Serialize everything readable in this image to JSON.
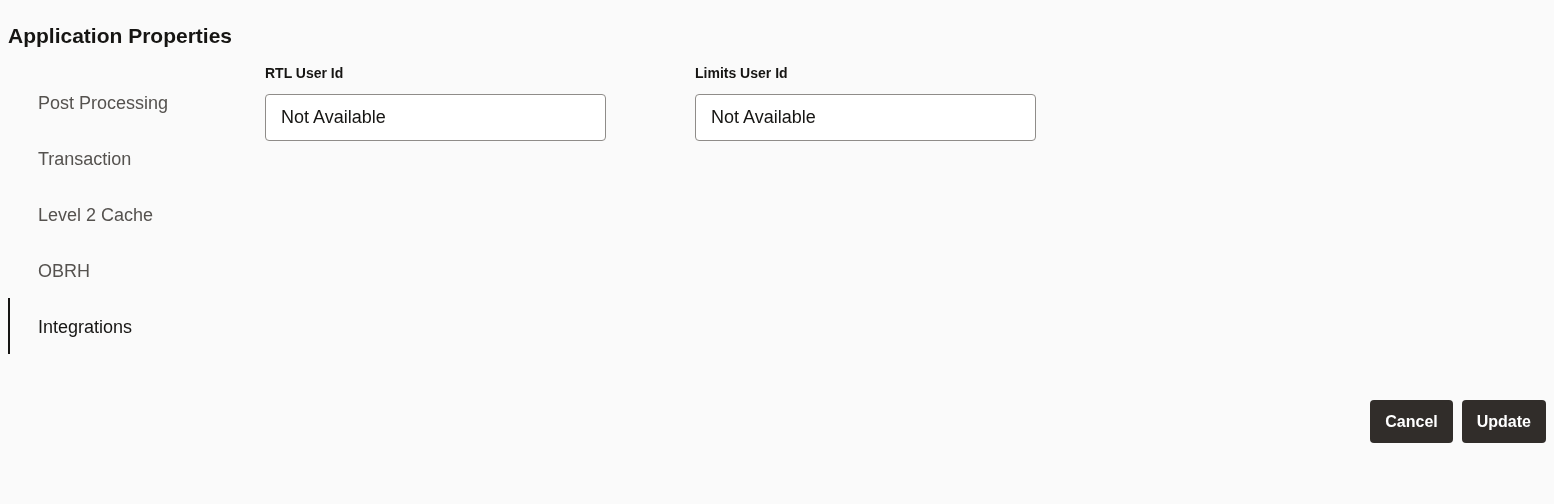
{
  "title": "Application Properties",
  "nav": [
    {
      "label": "Post Processing",
      "selected": false
    },
    {
      "label": "Transaction",
      "selected": false
    },
    {
      "label": "Level 2 Cache",
      "selected": false
    },
    {
      "label": "OBRH",
      "selected": false
    },
    {
      "label": "Integrations",
      "selected": true
    }
  ],
  "fields": [
    {
      "label": "RTL User Id",
      "value": "Not Available"
    },
    {
      "label": "Limits User Id",
      "value": "Not Available"
    }
  ],
  "buttons": [
    "Cancel",
    "Update"
  ]
}
